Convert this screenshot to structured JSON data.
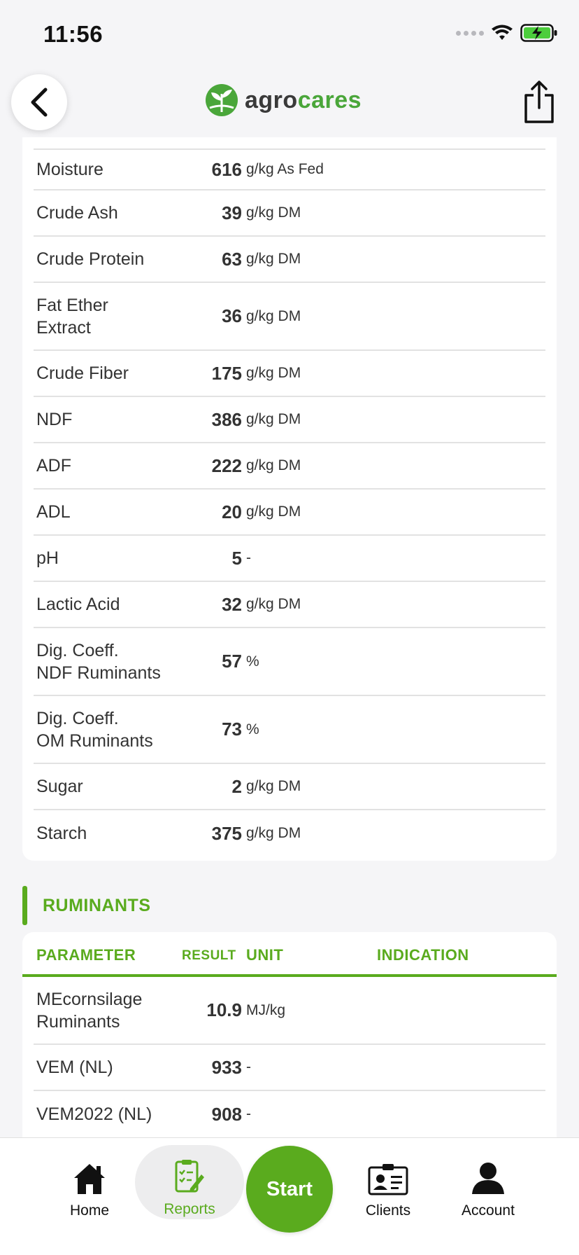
{
  "status": {
    "time": "11:56"
  },
  "header": {
    "logo_part1": "agro",
    "logo_part2": "cares"
  },
  "nutrients": [
    {
      "param": "",
      "result": "",
      "unit": ""
    },
    {
      "param": "Moisture",
      "result": "616",
      "unit": "g/kg As Fed"
    },
    {
      "param": "Crude Ash",
      "result": "39",
      "unit": "g/kg DM"
    },
    {
      "param": "Crude Protein",
      "result": "63",
      "unit": "g/kg DM"
    },
    {
      "param": "Fat Ether\nExtract",
      "result": "36",
      "unit": "g/kg DM"
    },
    {
      "param": "Crude Fiber",
      "result": "175",
      "unit": "g/kg DM"
    },
    {
      "param": "NDF",
      "result": "386",
      "unit": "g/kg DM"
    },
    {
      "param": "ADF",
      "result": "222",
      "unit": "g/kg DM"
    },
    {
      "param": "ADL",
      "result": "20",
      "unit": "g/kg DM"
    },
    {
      "param": "pH",
      "result": "5",
      "unit": "-"
    },
    {
      "param": "Lactic Acid",
      "result": "32",
      "unit": "g/kg DM"
    },
    {
      "param": "Dig. Coeff.\nNDF Ruminants",
      "result": "57",
      "unit": "%"
    },
    {
      "param": "Dig. Coeff.\nOM Ruminants",
      "result": "73",
      "unit": "%"
    },
    {
      "param": "Sugar",
      "result": "2",
      "unit": "g/kg DM"
    },
    {
      "param": "Starch",
      "result": "375",
      "unit": "g/kg DM"
    }
  ],
  "ruminants": {
    "title": "RUMINANTS",
    "headers": {
      "parameter": "PARAMETER",
      "result": "RESULT",
      "unit": "UNIT",
      "indication": "INDICATION"
    },
    "rows": [
      {
        "param": "MEcornsilage\nRuminants",
        "result": "10.9",
        "unit": "MJ/kg"
      },
      {
        "param": "VEM (NL)",
        "result": "933",
        "unit": "-"
      },
      {
        "param": "VEM2022 (NL)",
        "result": "908",
        "unit": "-"
      }
    ]
  },
  "tabs": {
    "home": "Home",
    "reports": "Reports",
    "start": "Start",
    "clients": "Clients",
    "account": "Account"
  },
  "colors": {
    "accent": "#5aab1e",
    "brand_green": "#4aa63a"
  }
}
